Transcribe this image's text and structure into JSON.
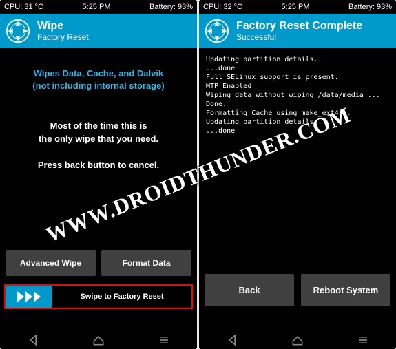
{
  "left": {
    "status": {
      "cpu": "CPU: 31 °C",
      "time": "5:25 PM",
      "battery": "Battery: 93%"
    },
    "header": {
      "title": "Wipe",
      "subtitle": "Factory Reset"
    },
    "info1a": "Wipes Data, Cache, and Dalvik",
    "info1b": "(not including internal storage)",
    "info2a": "Most of the time this is",
    "info2b": "the only wipe that you need.",
    "info3": "Press back button to cancel.",
    "btn_advanced": "Advanced Wipe",
    "btn_format": "Format Data",
    "swipe_label": "Swipe to Factory Reset"
  },
  "right": {
    "status": {
      "cpu": "CPU: 32 °C",
      "time": "5:25 PM",
      "battery": "Battery: 93%"
    },
    "header": {
      "title": "Factory Reset Complete",
      "subtitle": "Successful"
    },
    "log": "Updating partition details...\n...done\nFull SELinux support is present.\nMTP Enabled\nWiping data without wiping /data/media ...\nDone.\nFormatting Cache using make_ext4fs.\nUpdating partition details...\n...done",
    "btn_back": "Back",
    "btn_reboot": "Reboot System"
  },
  "watermark": "WWW.DROIDTHUNDER.COM"
}
